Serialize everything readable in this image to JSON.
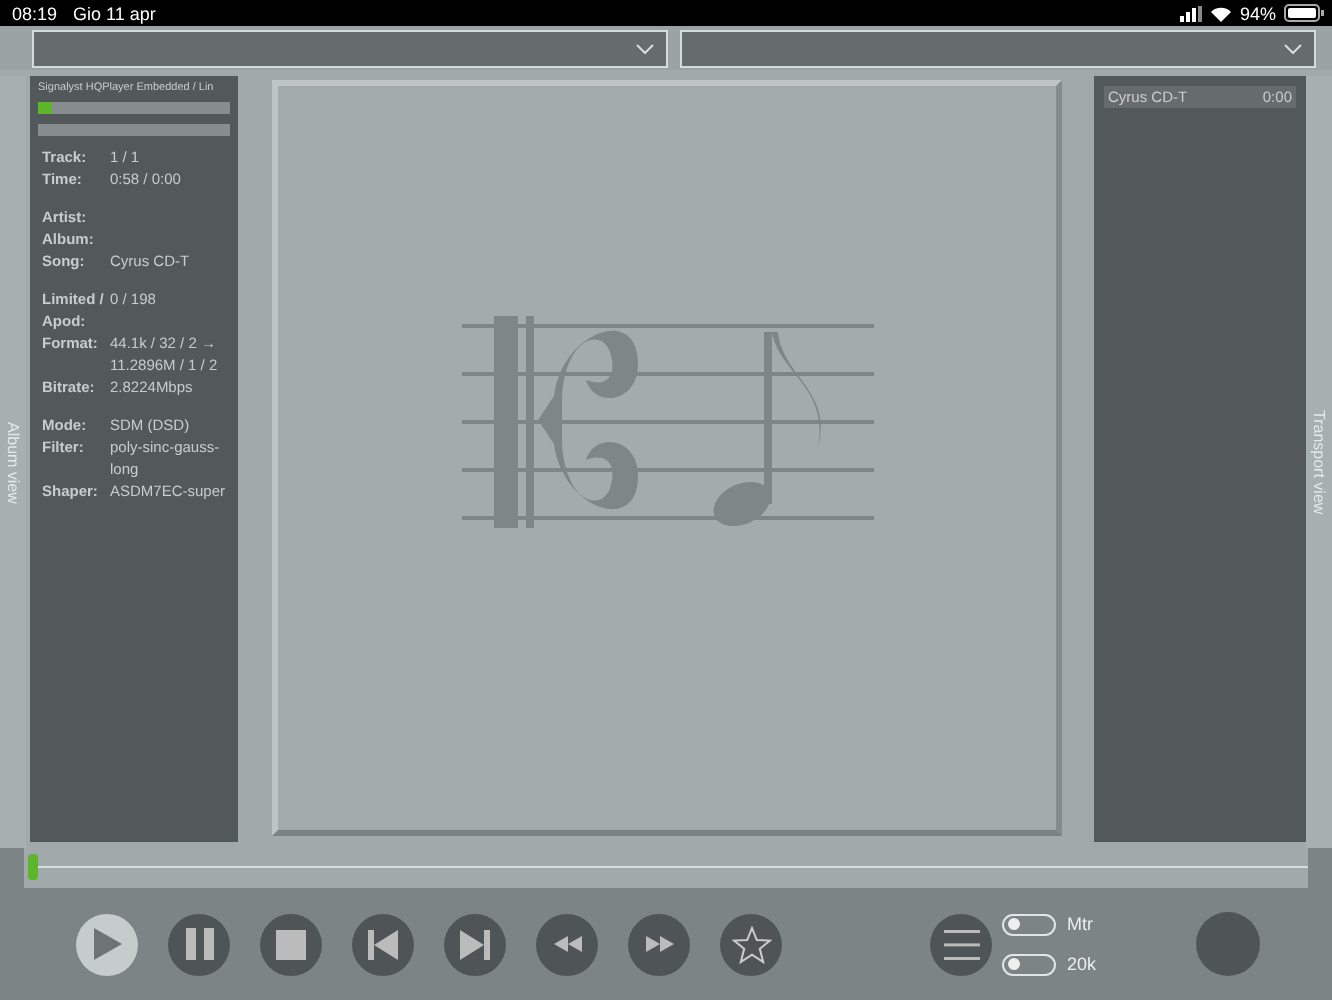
{
  "status_bar": {
    "time": "08:19",
    "date": "Gio 11 apr",
    "battery": "94%"
  },
  "dropdowns": [
    {
      "expanded": false
    },
    {
      "expanded": false
    }
  ],
  "side_tabs": {
    "left": "Album view",
    "right": "Transport view"
  },
  "info_panel": {
    "source": "Signalyst HQPlayer Embedded / Lin",
    "meters": [
      {
        "level": 0.07
      }
    ],
    "groups": [
      {
        "rows": [
          {
            "label": "Track:",
            "value": "1 / 1"
          },
          {
            "label": "Time:",
            "value": "0:58 / 0:00"
          }
        ]
      },
      {
        "rows": [
          {
            "label": "Artist:"
          },
          {
            "label": "Album:"
          },
          {
            "label": "Song:",
            "value": "Cyrus CD-T"
          }
        ]
      },
      {
        "rows": [
          {
            "label": "Limited / Apod:",
            "value": "0 / 198"
          },
          {
            "label": "Format:",
            "value": "44.1k / 32 / 2 → 11.2896M / 1 / 2"
          },
          {
            "label": "Bitrate:",
            "value": "2.8224Mbps"
          }
        ]
      },
      {
        "rows": [
          {
            "label": "Mode:",
            "value": "SDM (DSD)"
          },
          {
            "label": "Filter:",
            "value": "poly-sinc-gauss-long"
          },
          {
            "label": "Shaper:",
            "value": "ASDM7EC-super"
          }
        ]
      }
    ]
  },
  "playlist": [
    {
      "title": "Cyrus CD-T",
      "time": "0:00",
      "selected": true
    }
  ],
  "seek": {
    "level": 0.0
  },
  "transport": [
    {
      "kind": "play",
      "active": true
    },
    {
      "kind": "pause",
      "active": false
    },
    {
      "kind": "stop",
      "active": false
    },
    {
      "kind": "previous",
      "active": false
    },
    {
      "kind": "next",
      "active": false
    },
    {
      "kind": "rewind",
      "active": false
    },
    {
      "kind": "forward",
      "active": false
    },
    {
      "kind": "favorite",
      "active": false
    }
  ],
  "toggles": [
    {
      "label": "Mtr",
      "on": false
    },
    {
      "label": "20k",
      "on": false
    }
  ]
}
